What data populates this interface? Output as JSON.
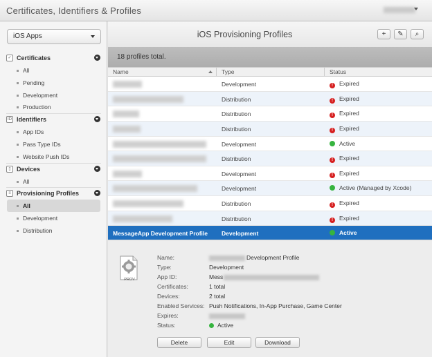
{
  "app": {
    "title": "Certificates, Identifiers & Profiles",
    "account_icon": "chevron-down-icon"
  },
  "sidebar": {
    "platform": "iOS Apps",
    "sections": [
      {
        "label": "Certificates",
        "icon": "certificate-icon",
        "items": [
          {
            "label": "All"
          },
          {
            "label": "Pending"
          },
          {
            "label": "Development"
          },
          {
            "label": "Production"
          }
        ]
      },
      {
        "label": "Identifiers",
        "icon": "id-icon",
        "items": [
          {
            "label": "App IDs"
          },
          {
            "label": "Pass Type IDs"
          },
          {
            "label": "Website Push IDs"
          }
        ]
      },
      {
        "label": "Devices",
        "icon": "device-icon",
        "items": [
          {
            "label": "All"
          }
        ]
      },
      {
        "label": "Provisioning Profiles",
        "icon": "profile-icon",
        "items": [
          {
            "label": "All",
            "selected": true
          },
          {
            "label": "Development"
          },
          {
            "label": "Distribution"
          }
        ]
      }
    ]
  },
  "main": {
    "title": "iOS Provisioning Profiles",
    "toolbar": {
      "add": "+",
      "edit": "✎",
      "search": "⌕"
    },
    "count_text": "18 profiles total.",
    "columns": {
      "name": "Name",
      "type": "Type",
      "status": "Status"
    },
    "rows": [
      {
        "type": "Development",
        "status": "Expired"
      },
      {
        "type": "Distribution",
        "status": "Expired"
      },
      {
        "type": "Distribution",
        "status": "Expired"
      },
      {
        "type": "Distribution",
        "status": "Expired"
      },
      {
        "type": "Development",
        "status": "Active"
      },
      {
        "type": "Distribution",
        "status": "Expired"
      },
      {
        "type": "Development",
        "status": "Expired"
      },
      {
        "type": "Development",
        "status": "Active (Managed by Xcode)"
      },
      {
        "type": "Distribution",
        "status": "Expired"
      },
      {
        "type": "Distribution",
        "status": "Expired"
      },
      {
        "name": "MessageApp Development Profile",
        "type": "Development",
        "status": "Active",
        "selected": true
      }
    ]
  },
  "details": {
    "icon_label": "PROV",
    "fields": [
      {
        "label": "Name:",
        "value": "Development Profile"
      },
      {
        "label": "Type:",
        "value": "Development"
      },
      {
        "label": "App ID:",
        "value": "Mess"
      },
      {
        "label": "Certificates:",
        "value": "1 total"
      },
      {
        "label": "Devices:",
        "value": "2 total"
      },
      {
        "label": "Enabled Services:",
        "value": "Push Notifications, In-App Purchase, Game Center"
      },
      {
        "label": "Expires:",
        "value": ""
      },
      {
        "label": "Status:",
        "value": "Active"
      }
    ],
    "buttons": {
      "delete": "Delete",
      "edit": "Edit",
      "download": "Download"
    }
  }
}
